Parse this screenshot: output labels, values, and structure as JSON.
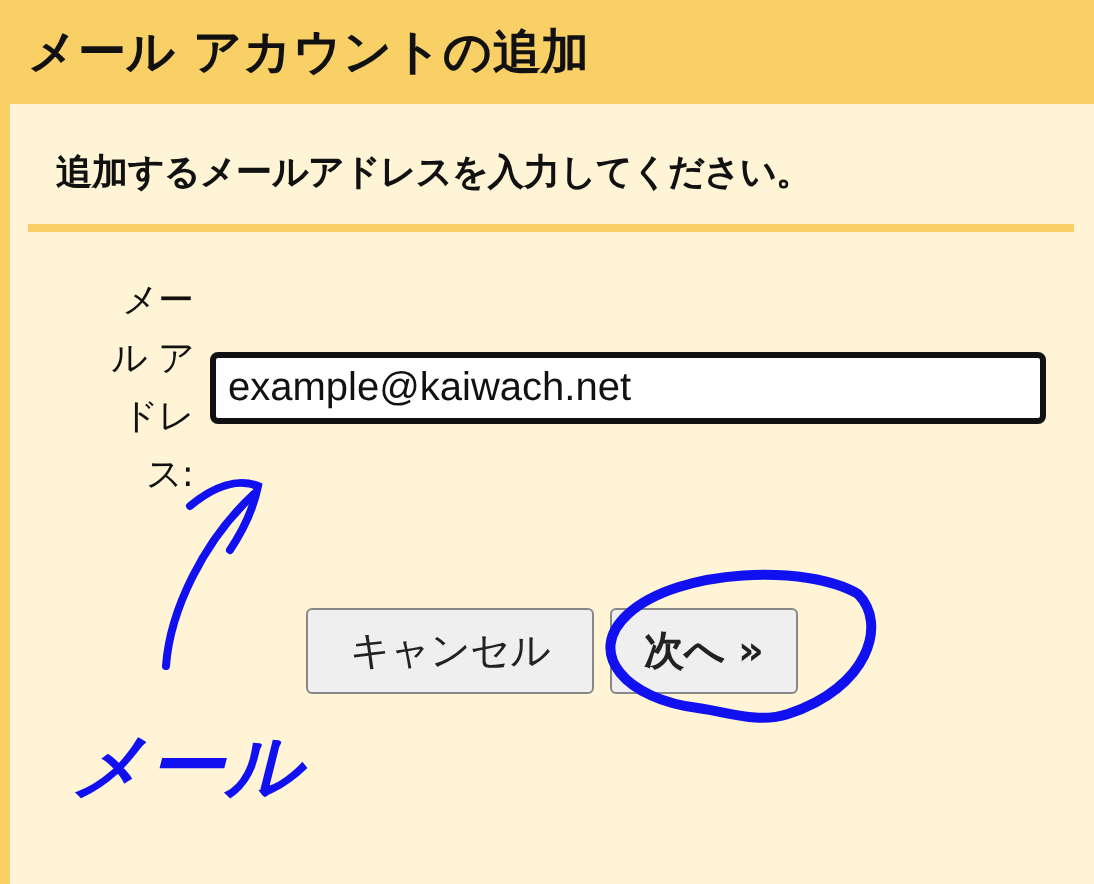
{
  "window": {
    "title": "メール アカウントの追加"
  },
  "instruction": "追加するメールアドレスを入力してください。",
  "email_field": {
    "label": "メール アドレス:",
    "value": "example@kaiwach.net"
  },
  "buttons": [
    {
      "label": "キャンセル",
      "kind": "secondary"
    },
    {
      "label": "次へ »",
      "kind": "primary"
    }
  ],
  "annotation": {
    "text": "メール"
  }
}
